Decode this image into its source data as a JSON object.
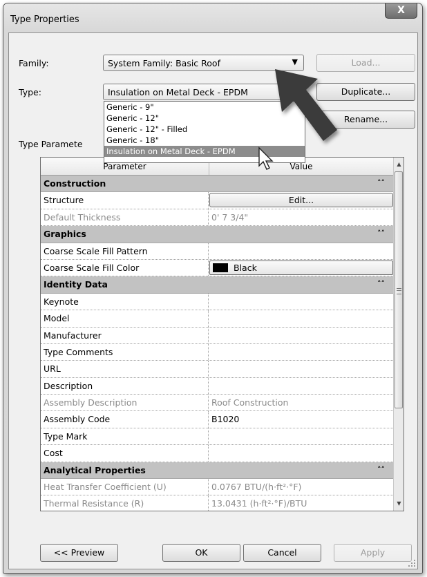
{
  "window": {
    "title": "Type Properties",
    "close_glyph": "X"
  },
  "family": {
    "label": "Family:",
    "value": "System Family: Basic Roof",
    "load_label": "Load..."
  },
  "type": {
    "label": "Type:",
    "value": "Insulation on Metal Deck - EPDM",
    "duplicate_label": "Duplicate...",
    "rename_label": "Rename...",
    "options": [
      {
        "label": "Generic - 9\""
      },
      {
        "label": "Generic - 12\""
      },
      {
        "label": "Generic - 12\" - Filled"
      },
      {
        "label": "Generic - 18\""
      },
      {
        "label": "Insulation on Metal Deck - EPDM"
      }
    ]
  },
  "type_parameters_label": "Type Paramete",
  "grid": {
    "columns": {
      "parameter": "Parameter",
      "value": "Value"
    },
    "groups": [
      {
        "title": "Construction",
        "rows": [
          {
            "name": "Structure",
            "value": "Edit...",
            "kind": "button"
          },
          {
            "name": "Default Thickness",
            "value": "0'  7 3/4\"",
            "kind": "readonly"
          }
        ]
      },
      {
        "title": "Graphics",
        "rows": [
          {
            "name": "Coarse Scale Fill Pattern",
            "value": ""
          },
          {
            "name": "Coarse Scale Fill Color",
            "value": "Black",
            "kind": "color"
          }
        ]
      },
      {
        "title": "Identity Data",
        "rows": [
          {
            "name": "Keynote",
            "value": ""
          },
          {
            "name": "Model",
            "value": ""
          },
          {
            "name": "Manufacturer",
            "value": ""
          },
          {
            "name": "Type Comments",
            "value": ""
          },
          {
            "name": "URL",
            "value": ""
          },
          {
            "name": "Description",
            "value": ""
          },
          {
            "name": "Assembly Description",
            "value": "Roof Construction",
            "kind": "readonly"
          },
          {
            "name": "Assembly Code",
            "value": "B1020"
          },
          {
            "name": "Type Mark",
            "value": ""
          },
          {
            "name": "Cost",
            "value": ""
          }
        ]
      },
      {
        "title": "Analytical Properties",
        "rows": [
          {
            "name": "Heat Transfer Coefficient (U)",
            "value": "0.0767 BTU/(h·ft²·°F)",
            "kind": "readonly"
          },
          {
            "name": "Thermal Resistance (R)",
            "value": "13.0431 (h·ft²·°F)/BTU",
            "kind": "readonly"
          }
        ]
      }
    ]
  },
  "footer": {
    "preview_label": "<< Preview",
    "ok_label": "OK",
    "cancel_label": "Cancel",
    "apply_label": "Apply"
  },
  "colors": {
    "group_header": "#c2c2c2",
    "selected_item": "#8c8c8c",
    "swatch_black": "#000000"
  }
}
